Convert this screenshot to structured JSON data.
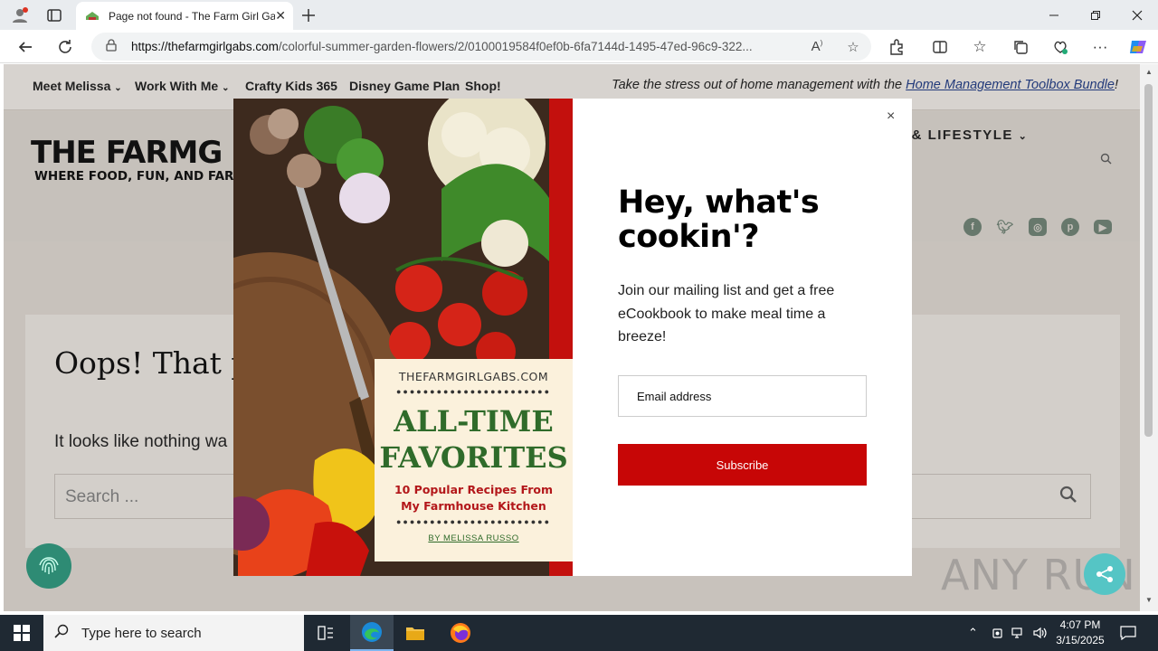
{
  "browser": {
    "tab_title": "Page not found - The Farm Girl Gabs",
    "url_host": "https://thefarmgirlgabs.com",
    "url_path": "/colorful-summer-garden-flowers/2/0100019584f0ef0b-6fa7144d-1495-47ed-96c9-322...",
    "icons": [
      "profile-icon",
      "tab-actions-icon",
      "close-tab-icon",
      "new-tab-icon",
      "back-icon",
      "refresh-icon",
      "lock-icon",
      "read-aloud-icon",
      "favorite-icon",
      "extensions-icon",
      "split-screen-icon",
      "favorites-icon",
      "collections-icon",
      "browser-essentials-icon",
      "more-icon",
      "copilot-icon",
      "minimize-icon",
      "maximize-icon",
      "close-icon"
    ]
  },
  "site": {
    "topnav": [
      "Meet Melissa",
      "Work With Me",
      "Crafty Kids 365",
      "Disney Game Plan",
      "Shop!"
    ],
    "promo_text": "Take the stress out of home management with the ",
    "promo_link": "Home Management Toolbox Bundle",
    "promo_end": "!",
    "logo_line1": "THE FARMG",
    "logo_line2": "WHERE FOOD, FUN, AND FARM",
    "mainnav_item": "EL & LIFESTYLE",
    "social": [
      "facebook-icon",
      "twitter-icon",
      "instagram-icon",
      "pinterest-icon",
      "youtube-icon"
    ]
  },
  "content": {
    "heading": "Oops! That pa",
    "message": "It looks like nothing wa",
    "search_placeholder": "Search ..."
  },
  "modal": {
    "close": "×",
    "book_site": "THEFARMGIRLGABS.COM",
    "book_title_1": "ALL-TIME",
    "book_title_2": "FAVORITES",
    "book_subtitle_1": "10 Popular Recipes From",
    "book_subtitle_2": "My Farmhouse Kitchen",
    "book_author": "BY MELISSA RUSSO",
    "heading": "Hey, what's cookin'?",
    "description": "Join our mailing list and get a free eCookbook to make meal time a breeze!",
    "email_placeholder": "Email address",
    "subscribe": "Subscribe"
  },
  "watermark": "ANY RUN",
  "taskbar": {
    "search_placeholder": "Type here to search",
    "time": "4:07 PM",
    "date": "3/15/2025"
  }
}
